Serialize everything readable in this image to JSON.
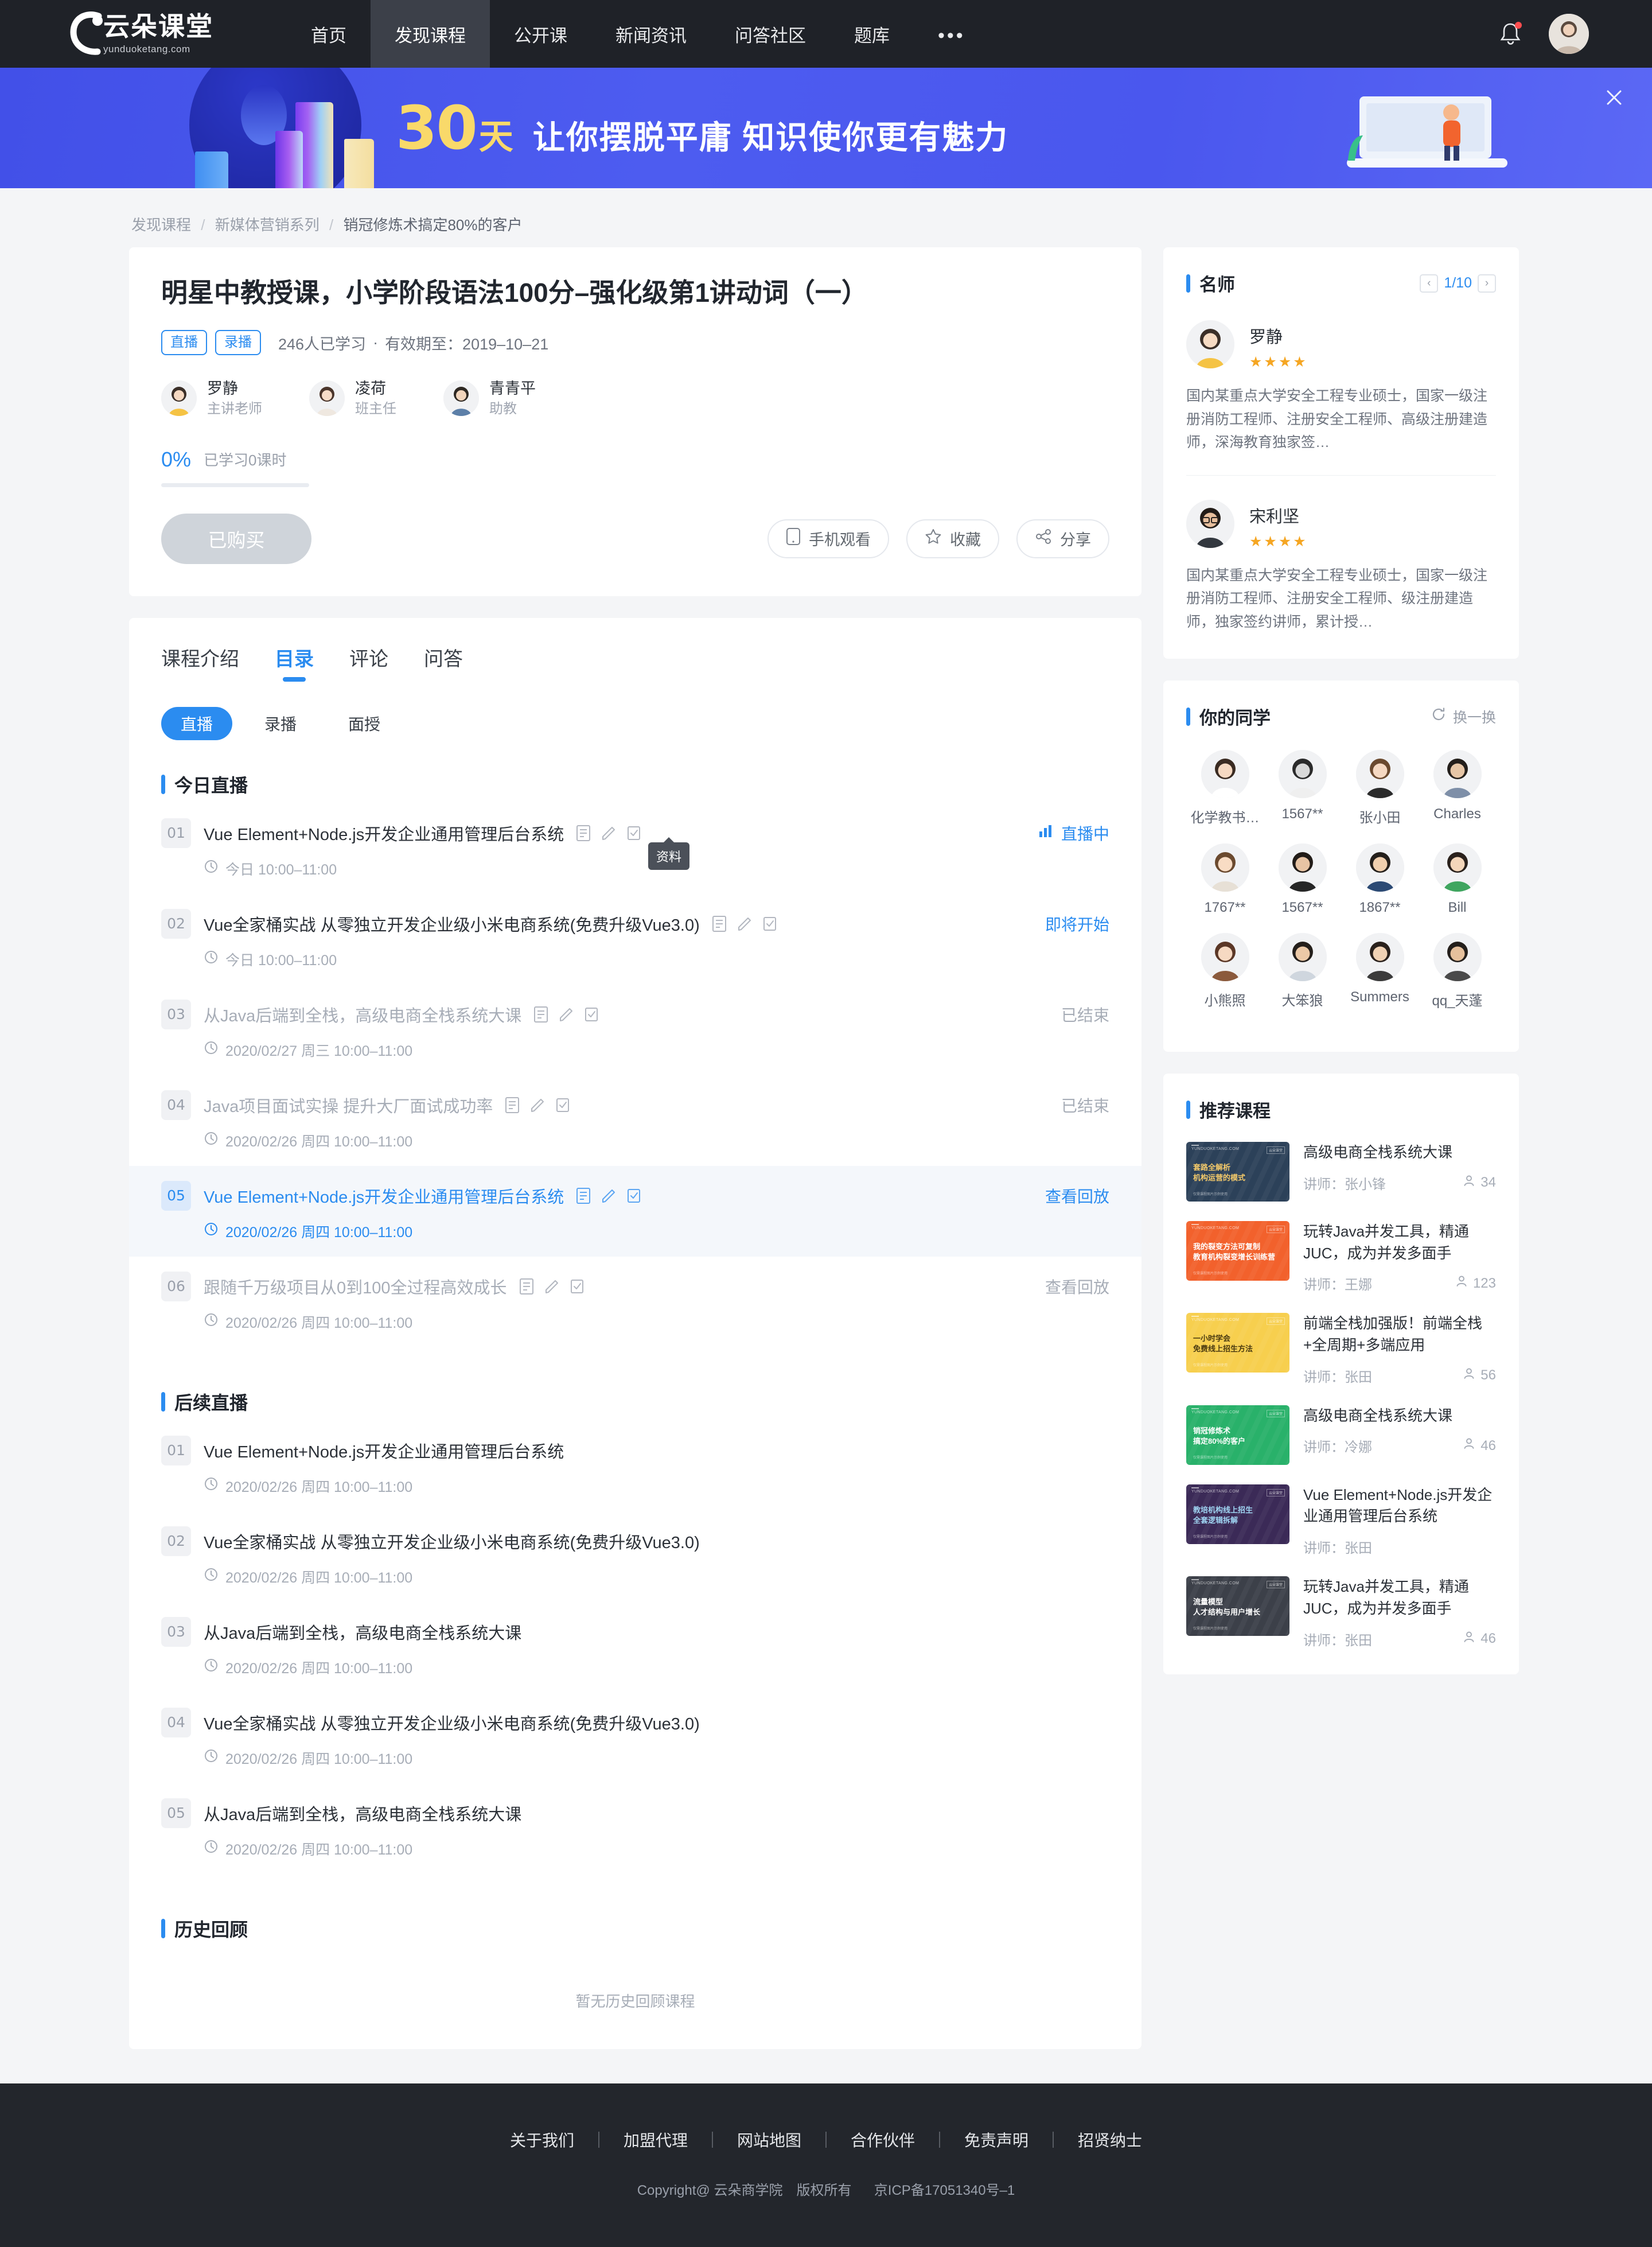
{
  "header": {
    "logo_cn": "云朵课堂",
    "logo_en": "yunduoketang.com",
    "nav": [
      {
        "label": "首页",
        "active": false
      },
      {
        "label": "发现课程",
        "active": true
      },
      {
        "label": "公开课",
        "active": false
      },
      {
        "label": "新闻资讯",
        "active": false
      },
      {
        "label": "问答社区",
        "active": false
      },
      {
        "label": "题库",
        "active": false
      }
    ],
    "more": "•••"
  },
  "banner": {
    "number": "30",
    "day_unit": "天",
    "text": "让你摆脱平庸  知识使你更有魅力",
    "close_icon": "close-icon"
  },
  "breadcrumb": {
    "item1": "发现课程",
    "item2": "新媒体营销系列",
    "current": "销冠修炼术搞定80%的客户",
    "sep": "/"
  },
  "course": {
    "title": "明星中教授课，小学阶段语法100分–强化级第1讲动词（一）",
    "tags": [
      "直播",
      "录播"
    ],
    "learners": "246人已学习",
    "dot": "·",
    "validity": "有效期至：2019–10–21",
    "teachers": [
      {
        "name": "罗静",
        "role": "主讲老师"
      },
      {
        "name": "凌荷",
        "role": "班主任"
      },
      {
        "name": "青青平",
        "role": "助教"
      }
    ],
    "progress_pct": "0%",
    "progress_value": 0,
    "progress_label": "已学习0课时",
    "buy_button": "已购买",
    "actions": [
      {
        "label": "手机观看",
        "icon": "phone-icon"
      },
      {
        "label": "收藏",
        "icon": "star-icon"
      },
      {
        "label": "分享",
        "icon": "share-icon"
      }
    ]
  },
  "tabs": [
    {
      "label": "课程介绍",
      "active": false
    },
    {
      "label": "目录",
      "active": true
    },
    {
      "label": "评论",
      "active": false
    },
    {
      "label": "问答",
      "active": false
    }
  ],
  "subfilter": [
    {
      "label": "直播",
      "on": true
    },
    {
      "label": "录播",
      "on": false
    },
    {
      "label": "面授",
      "on": false
    }
  ],
  "tooltip": {
    "text": "资料"
  },
  "sections": {
    "today": {
      "title": "今日直播",
      "lessons": [
        {
          "num": "01",
          "title": "Vue Element+Node.js开发企业通用管理后台系统",
          "time": "今日 10:00–11:00",
          "status": "直播中",
          "status_style": "blue-live",
          "row_style": "normal",
          "icons": true
        },
        {
          "num": "02",
          "title": "Vue全家桶实战 从零独立开发企业级小米电商系统(免费升级Vue3.0)",
          "time": "今日 10:00–11:00",
          "status": "即将开始",
          "status_style": "blue",
          "row_style": "normal",
          "icons": true
        },
        {
          "num": "03",
          "title": "从Java后端到全栈，高级电商全栈系统大课",
          "time": "2020/02/27 周三 10:00–11:00",
          "status": "已结束",
          "status_style": "grey",
          "row_style": "dim",
          "icons": true
        },
        {
          "num": "04",
          "title": "Java项目面试实操 提升大厂面试成功率",
          "time": "2020/02/26 周四 10:00–11:00",
          "status": "已结束",
          "status_style": "grey",
          "row_style": "dim",
          "icons": true
        },
        {
          "num": "05",
          "title": "Vue Element+Node.js开发企业通用管理后台系统",
          "time": "2020/02/26 周四 10:00–11:00",
          "status": "查看回放",
          "status_style": "blue",
          "row_style": "highlight",
          "icons": true
        },
        {
          "num": "06",
          "title": "跟随千万级项目从0到100全过程高效成长",
          "time": "2020/02/26 周四 10:00–11:00",
          "status": "查看回放",
          "status_style": "grey",
          "row_style": "dim",
          "icons": true
        }
      ]
    },
    "upcoming": {
      "title": "后续直播",
      "lessons": [
        {
          "num": "01",
          "title": "Vue Element+Node.js开发企业通用管理后台系统",
          "time": "2020/02/26 周四 10:00–11:00",
          "status": "",
          "status_style": "none",
          "row_style": "normal",
          "icons": false
        },
        {
          "num": "02",
          "title": "Vue全家桶实战 从零独立开发企业级小米电商系统(免费升级Vue3.0)",
          "time": "2020/02/26 周四 10:00–11:00",
          "status": "",
          "status_style": "none",
          "row_style": "normal",
          "icons": false
        },
        {
          "num": "03",
          "title": "从Java后端到全栈，高级电商全栈系统大课",
          "time": "2020/02/26 周四 10:00–11:00",
          "status": "",
          "status_style": "none",
          "row_style": "normal",
          "icons": false
        },
        {
          "num": "04",
          "title": "Vue全家桶实战 从零独立开发企业级小米电商系统(免费升级Vue3.0)",
          "time": "2020/02/26 周四 10:00–11:00",
          "status": "",
          "status_style": "none",
          "row_style": "normal",
          "icons": false
        },
        {
          "num": "05",
          "title": "从Java后端到全栈，高级电商全栈系统大课",
          "time": "2020/02/26 周四 10:00–11:00",
          "status": "",
          "status_style": "none",
          "row_style": "normal",
          "icons": false
        }
      ]
    },
    "history": {
      "title": "历史回顾",
      "empty": "暂无历史回顾课程"
    }
  },
  "famous_panel": {
    "title": "名师",
    "page": "1/10",
    "prev_icon": "chevron-left-icon",
    "next_icon": "chevron-right-icon",
    "teachers": [
      {
        "name": "罗静",
        "stars": "★★★★",
        "desc": "国内某重点大学安全工程专业硕士，国家一级注册消防工程师、注册安全工程师、高级注册建造师，深海教育独家签…"
      },
      {
        "name": "宋利坚",
        "stars": "★★★★",
        "desc": "国内某重点大学安全工程专业硕士，国家一级注册消防工程师、注册安全工程师、级注册建造师，独家签约讲师，累计授…"
      }
    ]
  },
  "mates_panel": {
    "title": "你的同学",
    "refresh_label": "换一换",
    "refresh_icon": "refresh-icon",
    "mates": [
      {
        "name": "化学教书…"
      },
      {
        "name": "1567**"
      },
      {
        "name": "张小田"
      },
      {
        "name": "Charles"
      },
      {
        "name": "1767**"
      },
      {
        "name": "1567**"
      },
      {
        "name": "1867**"
      },
      {
        "name": "Bill"
      },
      {
        "name": "小熊照"
      },
      {
        "name": "大笨狼"
      },
      {
        "name": "Summers"
      },
      {
        "name": "qq_天蓬"
      }
    ]
  },
  "recommend_panel": {
    "title": "推荐课程",
    "teacher_prefix": "讲师：",
    "courses": [
      {
        "title": "高级电商全栈系统大课",
        "teacher": "张小锋",
        "count": "34",
        "thumb_bg": "#2c4159",
        "thumb_t1": "套路全解析",
        "thumb_t2": "机构运营的模式",
        "thumb_color": "#f3c96a",
        "thumb_brand": "YUNDUOKETANG.COM",
        "thumb_badge": "云朵课堂",
        "thumb_foot": "仅需课程图片示例使用"
      },
      {
        "title": "玩转Java并发工具，精通JUC，成为并发多面手",
        "teacher": "王娜",
        "count": "123",
        "thumb_bg": "#f2612c",
        "thumb_t1": "我的裂变方法可复制",
        "thumb_t2": "教育机构裂变增长训练营",
        "thumb_color": "#ffffff",
        "thumb_brand": "YUNDUOKETANG.COM",
        "thumb_badge": "云朵课堂",
        "thumb_foot": "仅需课程图片示例使用"
      },
      {
        "title": "前端全栈加强版！前端全栈+全周期+多端应用",
        "teacher": "张田",
        "count": "56",
        "thumb_bg": "#f7cf4e",
        "thumb_t1": "一小时学会",
        "thumb_t2": "免费线上招生方法",
        "thumb_color": "#4a3a10",
        "thumb_brand": "YUNDUOKETANG.COM",
        "thumb_badge": "云朵课堂",
        "thumb_foot": "仅需课程图片示例使用"
      },
      {
        "title": "高级电商全栈系统大课",
        "teacher": "冷娜",
        "count": "46",
        "thumb_bg": "#29b16a",
        "thumb_t1": "销冠修炼术",
        "thumb_t2": "搞定80%的客户",
        "thumb_color": "#ffffff",
        "thumb_brand": "YUNDUOKETANG.COM",
        "thumb_badge": "云朵课堂",
        "thumb_foot": "仅需课程图片示例使用"
      },
      {
        "title": "Vue Element+Node.js开发企业通用管理后台系统",
        "teacher": "张田",
        "count": "",
        "thumb_bg": "#3b2a57",
        "thumb_t1": "教培机构线上招生",
        "thumb_t2": "全套逻辑拆解",
        "thumb_color": "#9fd4f2",
        "thumb_brand": "YUNDUOKETANG.COM",
        "thumb_badge": "云朵课堂",
        "thumb_foot": "仅需课程图片示例使用"
      },
      {
        "title": "玩转Java并发工具，精通JUC，成为并发多面手",
        "teacher": "张田",
        "count": "46",
        "thumb_bg": "#3c4049",
        "thumb_t1": "流量模型",
        "thumb_t2": "人才结构与用户增长",
        "thumb_color": "#ffffff",
        "thumb_brand": "YUNDUOKETANG.COM",
        "thumb_badge": "云朵课堂",
        "thumb_foot": "仅需课程图片示例使用"
      }
    ]
  },
  "footer": {
    "links": [
      "关于我们",
      "加盟代理",
      "网站地图",
      "合作伙伴",
      "免责声明",
      "招贤纳士"
    ],
    "copyright": "Copyright@ 云朵商学院　版权所有",
    "icp": "京ICP备17051340号–1"
  },
  "colors": {
    "accent": "#2b8cf0",
    "header_bg": "#1f2228",
    "banner_yellow": "#f9d96a",
    "star": "#f5a623"
  }
}
